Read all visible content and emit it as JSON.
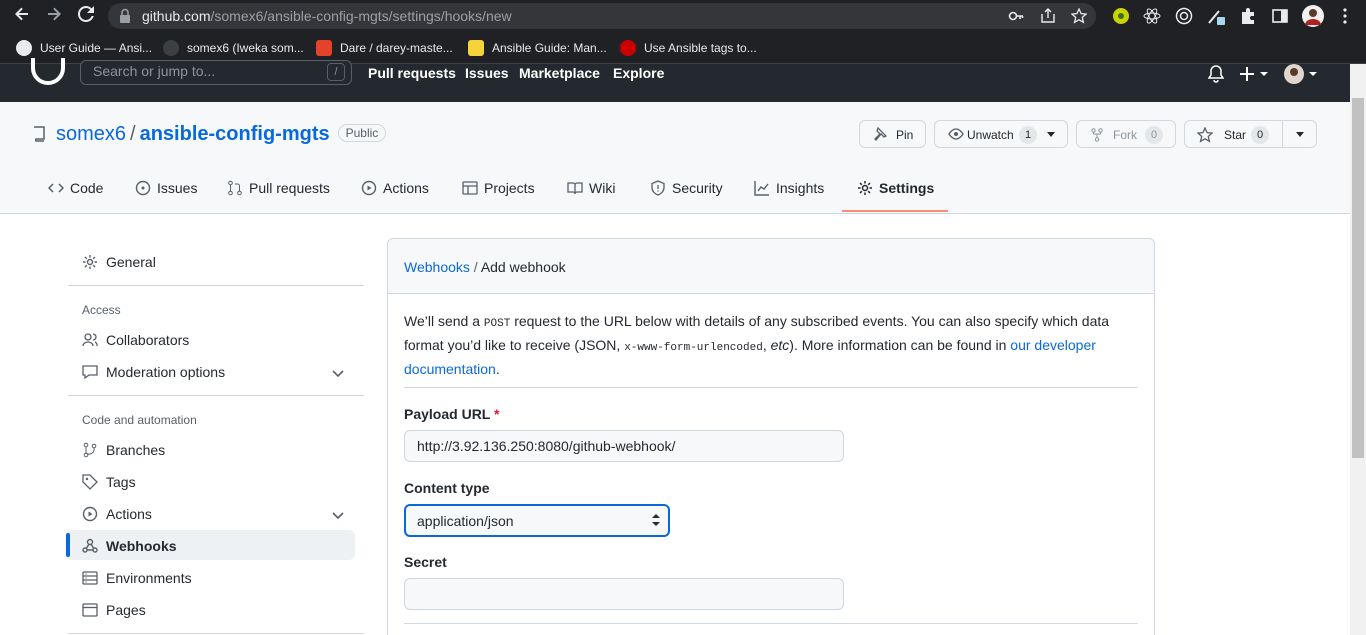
{
  "browser": {
    "url_host": "github.com",
    "url_path": "/somex6/ansible-config-mgts/settings/hooks/new",
    "bookmarks": [
      {
        "label": "User Guide — Ansi...",
        "icon": "globe-icon"
      },
      {
        "label": "somex6 (Iweka som...",
        "icon": "github-icon"
      },
      {
        "label": "Dare / darey-maste...",
        "icon": "gitlab-icon"
      },
      {
        "label": "Ansible Guide: Man...",
        "icon": "lightbulb-icon"
      },
      {
        "label": "Use Ansible tags to...",
        "icon": "redhat-icon"
      }
    ]
  },
  "github_header": {
    "search_placeholder": "Search or jump to...",
    "search_key": "/",
    "nav": [
      "Pull requests",
      "Issues",
      "Marketplace",
      "Explore"
    ]
  },
  "repo": {
    "owner": "somex6",
    "name": "ansible-config-mgts",
    "visibility": "Public",
    "pin_label": "Pin",
    "unwatch_label": "Unwatch",
    "watch_count": "1",
    "fork_label": "Fork",
    "fork_count": "0",
    "star_label": "Star",
    "star_count": "0"
  },
  "tabs": [
    {
      "label": "Code",
      "icon": "code-icon"
    },
    {
      "label": "Issues",
      "icon": "issue-icon"
    },
    {
      "label": "Pull requests",
      "icon": "pull-request-icon"
    },
    {
      "label": "Actions",
      "icon": "play-icon"
    },
    {
      "label": "Projects",
      "icon": "table-icon"
    },
    {
      "label": "Wiki",
      "icon": "book-icon"
    },
    {
      "label": "Security",
      "icon": "shield-icon"
    },
    {
      "label": "Insights",
      "icon": "graph-icon"
    },
    {
      "label": "Settings",
      "icon": "gear-icon",
      "active": true
    }
  ],
  "sidebar": {
    "general": "General",
    "access_heading": "Access",
    "collaborators": "Collaborators",
    "moderation": "Moderation options",
    "code_heading": "Code and automation",
    "branches": "Branches",
    "tags": "Tags",
    "actions": "Actions",
    "webhooks": "Webhooks",
    "environments": "Environments",
    "pages": "Pages"
  },
  "form": {
    "crumb_link": "Webhooks",
    "crumb_sep": "/",
    "crumb_current": "Add webhook",
    "intro_1": "We’ll send a ",
    "intro_code_1": "POST",
    "intro_2": " request to the URL below with details of any subscribed events. You can also specify which data format you’d like to receive (JSON, ",
    "intro_code_2": "x-www-form-urlencoded",
    "intro_3": ", ",
    "intro_etc": "etc",
    "intro_4": "). More information can be found in ",
    "intro_link": "our developer documentation",
    "intro_5": ".",
    "payload_label": "Payload URL",
    "payload_required": "*",
    "payload_value": "http://3.92.136.250:8080/github-webhook/",
    "content_type_label": "Content type",
    "content_type_value": "application/json",
    "secret_label": "Secret",
    "secret_value": ""
  },
  "colors": {
    "accent": "#0969da",
    "tab_underline": "#fd8c73",
    "header_bg": "#24292f",
    "chrome_bg": "#202124"
  }
}
